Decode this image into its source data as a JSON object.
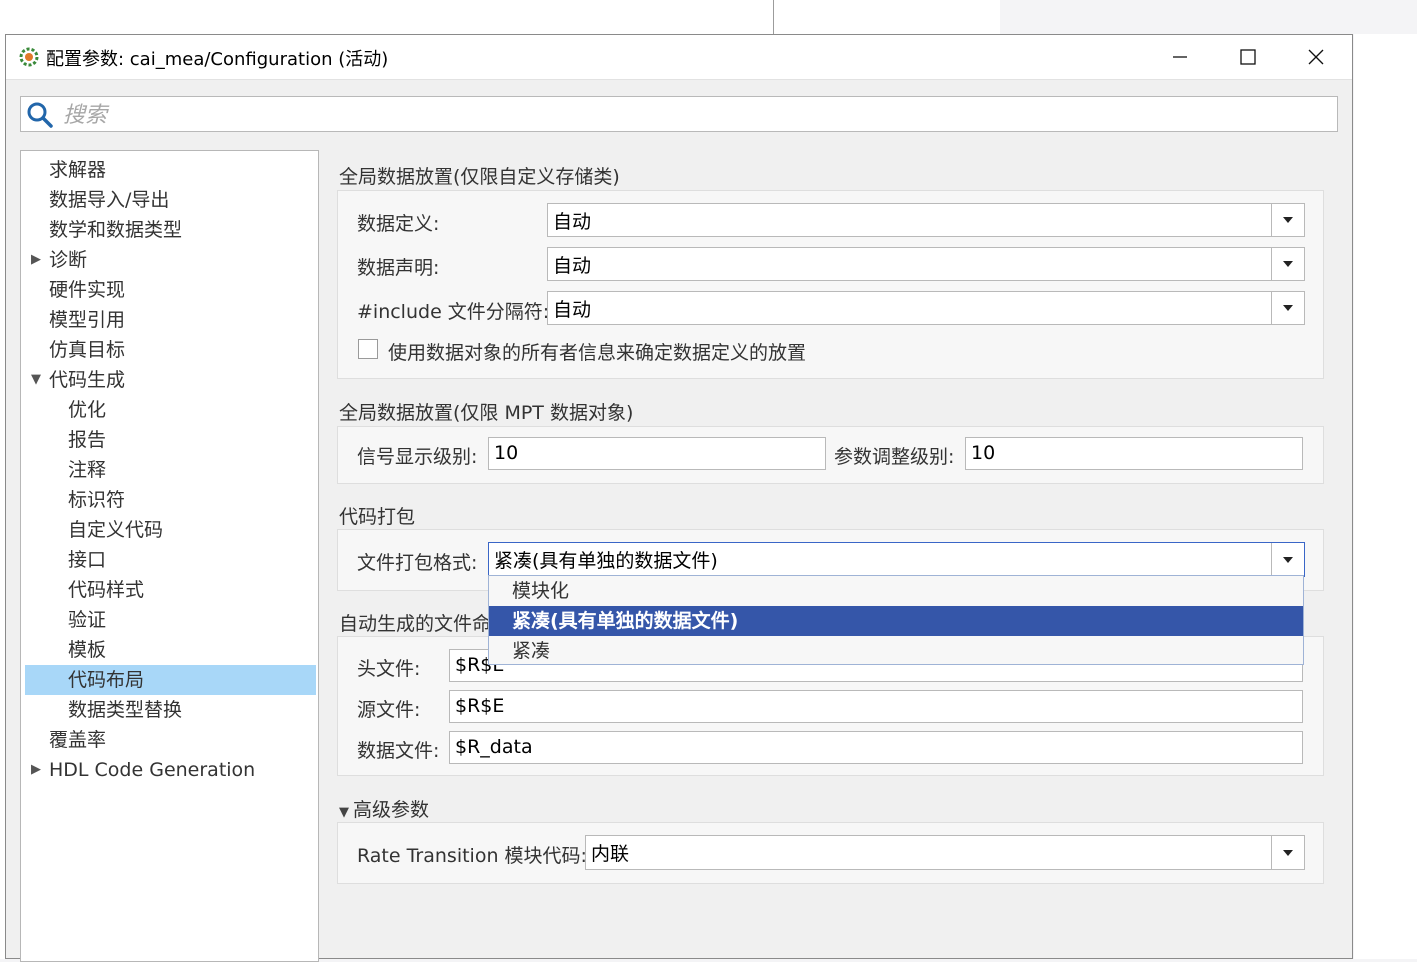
{
  "window": {
    "title": "配置参数: cai_mea/Configuration (活动)"
  },
  "search": {
    "placeholder": "搜索"
  },
  "tree": {
    "items": [
      {
        "label": "求解器"
      },
      {
        "label": "数据导入/导出"
      },
      {
        "label": "数学和数据类型"
      },
      {
        "label": "诊断",
        "expander": "collapsed"
      },
      {
        "label": "硬件实现"
      },
      {
        "label": "模型引用"
      },
      {
        "label": "仿真目标"
      },
      {
        "label": "代码生成",
        "expander": "expanded"
      },
      {
        "label": "优化"
      },
      {
        "label": "报告"
      },
      {
        "label": "注释"
      },
      {
        "label": "标识符"
      },
      {
        "label": "自定义代码"
      },
      {
        "label": "接口"
      },
      {
        "label": "代码样式"
      },
      {
        "label": "验证"
      },
      {
        "label": "模板"
      },
      {
        "label": "代码布局",
        "selected": true
      },
      {
        "label": "数据类型替换"
      },
      {
        "label": "覆盖率"
      },
      {
        "label": "HDL Code Generation",
        "expander": "collapsed"
      }
    ]
  },
  "global_placement": {
    "title": "全局数据放置(仅限自定义存储类)",
    "data_definition_label": "数据定义:",
    "data_definition_value": "自动",
    "data_declaration_label": "数据声明:",
    "data_declaration_value": "自动",
    "include_separator_label": "#include 文件分隔符:",
    "include_separator_value": "自动",
    "owner_checkbox_label": "使用数据对象的所有者信息来确定数据定义的放置",
    "owner_checkbox_checked": false
  },
  "mpt_placement": {
    "title": "全局数据放置(仅限 MPT 数据对象)",
    "signal_level_label": "信号显示级别:",
    "signal_level_value": "10",
    "param_level_label": "参数调整级别:",
    "param_level_value": "10"
  },
  "code_packaging": {
    "title": "代码打包",
    "file_format_label": "文件打包格式:",
    "file_format_value": "紧凑(具有单独的数据文件)",
    "options": [
      {
        "label": "模块化"
      },
      {
        "label": "紧凑(具有单独的数据文件)",
        "active": true
      },
      {
        "label": "紧凑"
      }
    ]
  },
  "generated_files": {
    "title": "自动生成的文件命",
    "header_label": "头文件:",
    "header_value": "$R$E",
    "source_label": "源文件:",
    "source_value": "$R$E",
    "data_label": "数据文件:",
    "data_value": "$R_data"
  },
  "advanced": {
    "title": "高级参数",
    "rate_transition_label": "Rate Transition 模块代码:",
    "rate_transition_value": "内联"
  },
  "colors": {
    "selection": "#a8d7f8",
    "dropdown_active": "#3556a9"
  }
}
